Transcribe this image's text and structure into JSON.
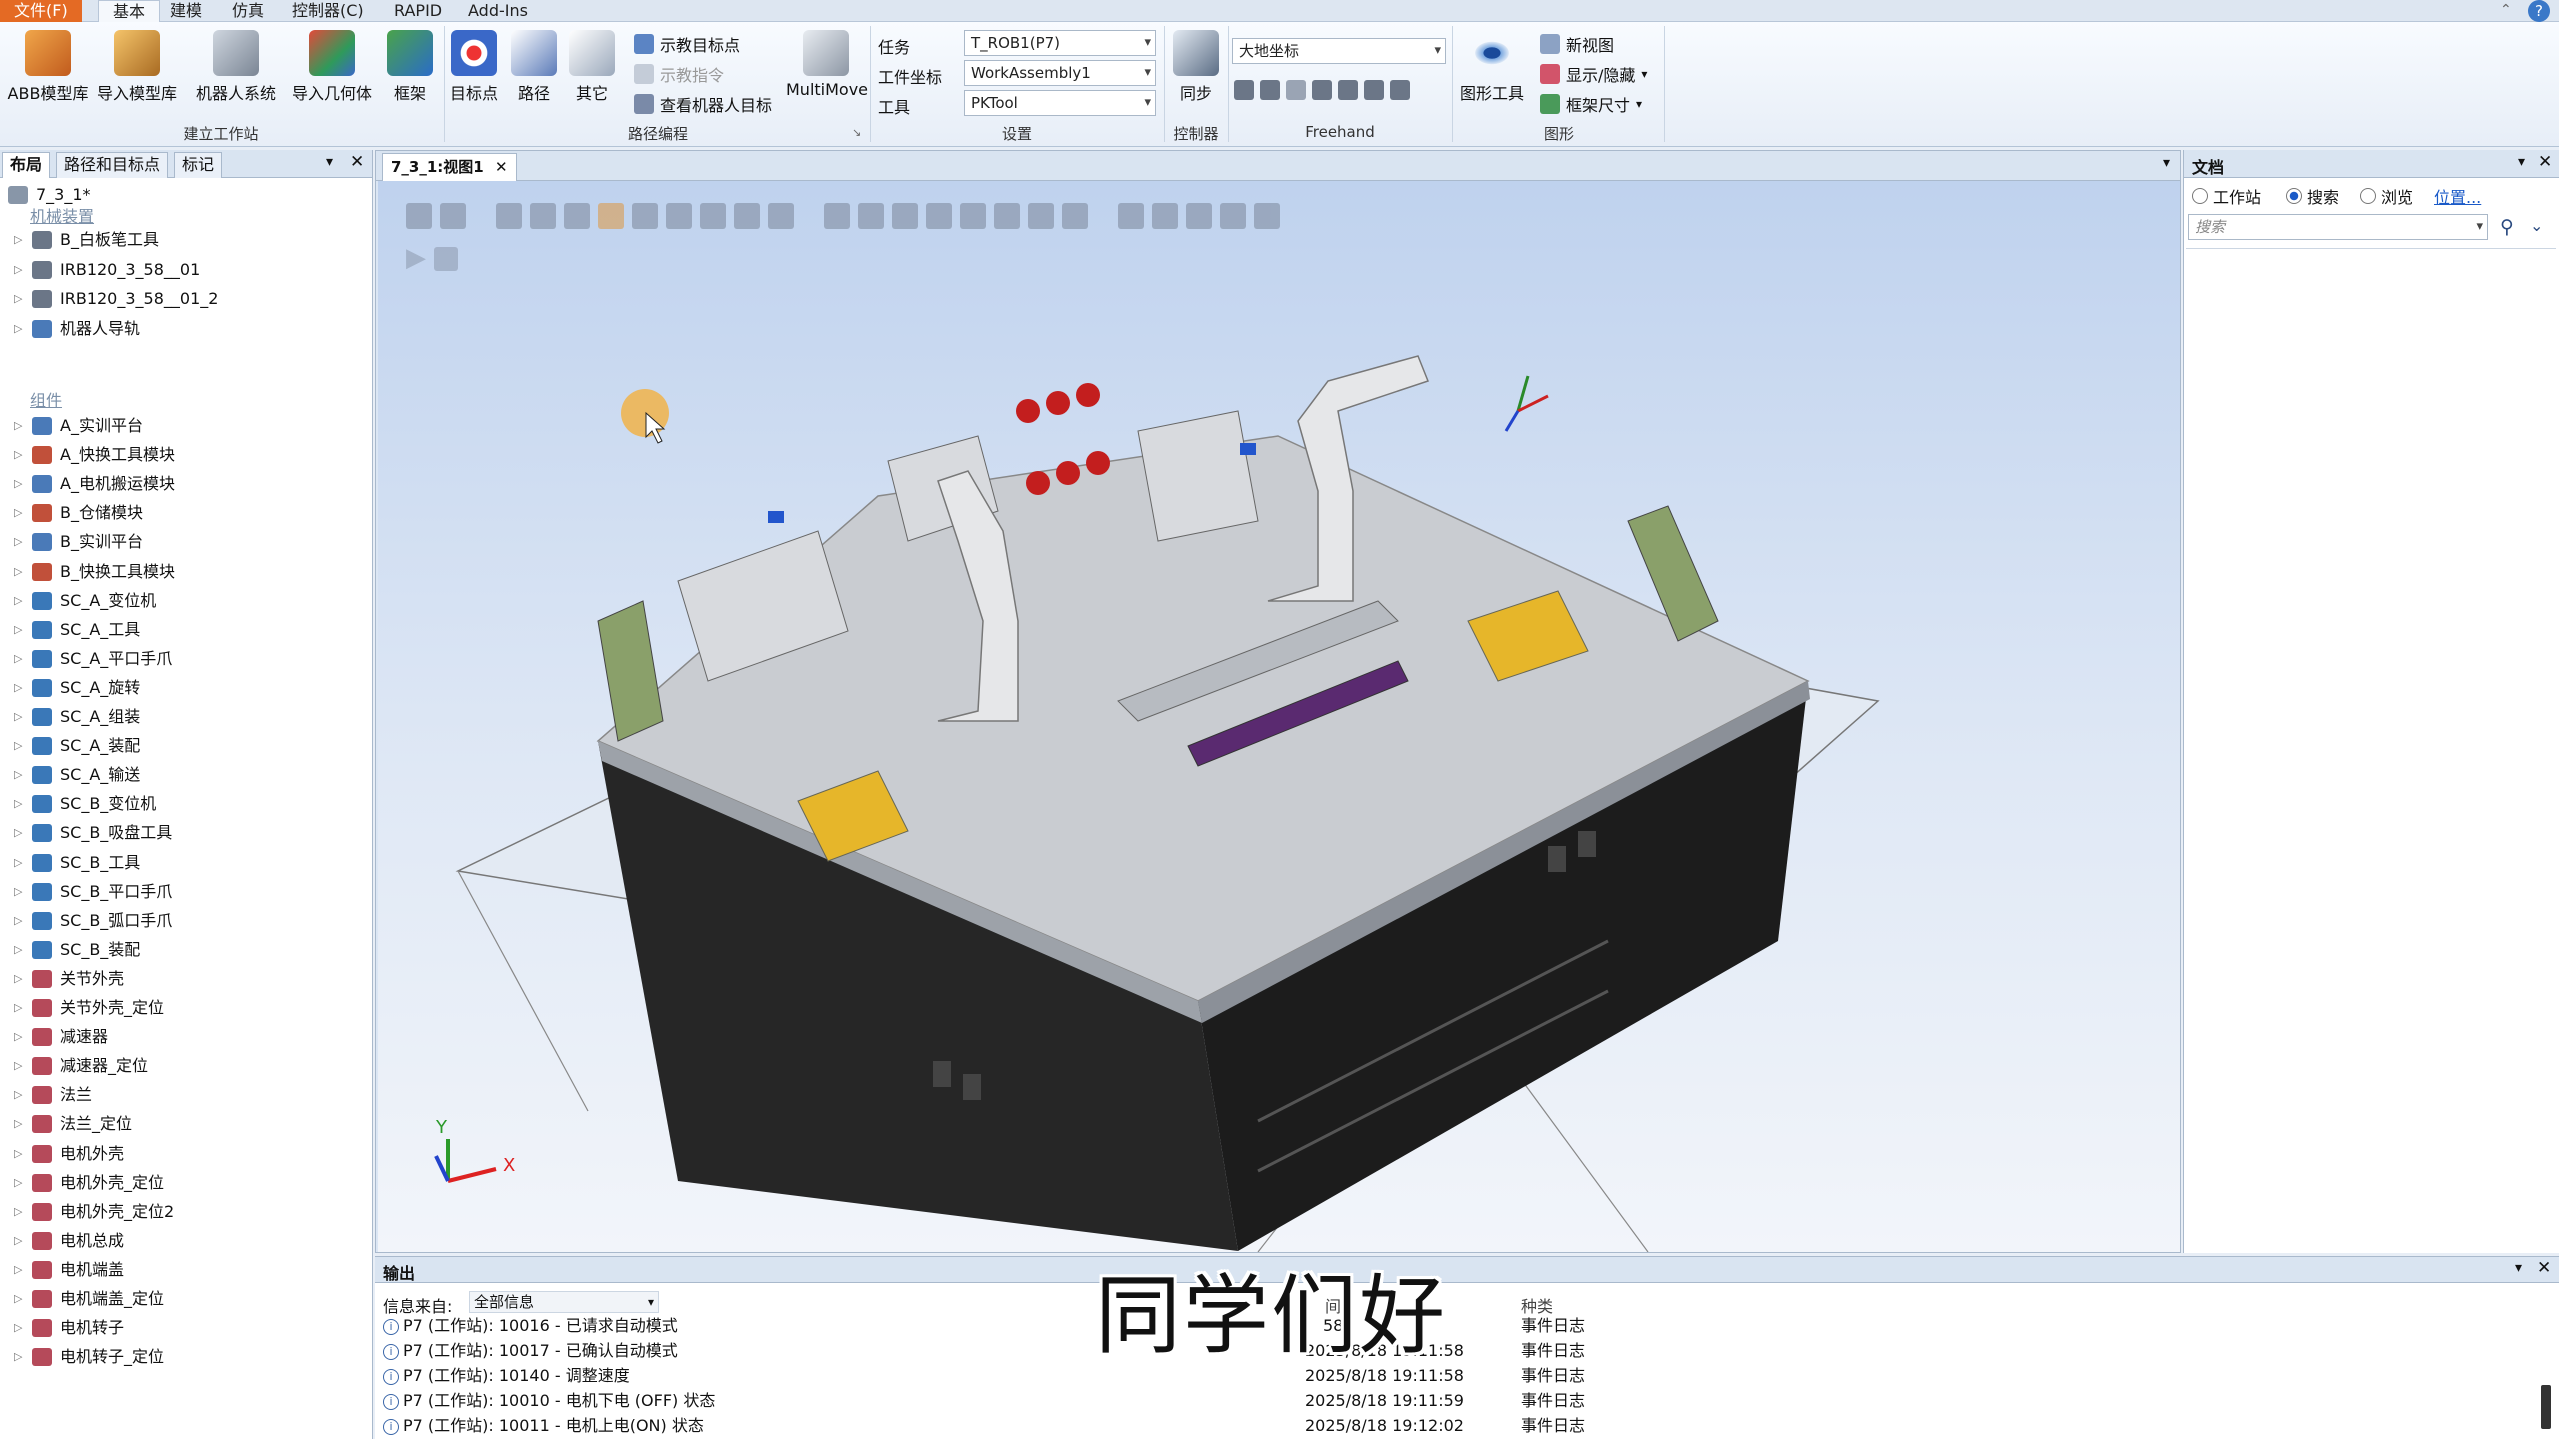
{
  "menu": {
    "file": "文件(F)",
    "tabs": [
      "基本",
      "建模",
      "仿真",
      "控制器(C)",
      "RAPID",
      "Add-Ins"
    ]
  },
  "ribbon": {
    "build_station": {
      "label": "建立工作站",
      "buttons": [
        "ABB模型库",
        "导入模型库",
        "机器人系统",
        "导入几何体",
        "框架"
      ]
    },
    "path_programming": {
      "label": "路径编程",
      "buttons": [
        "目标点",
        "路径",
        "其它"
      ],
      "small": [
        "示教目标点",
        "示教指令",
        "查看机器人目标"
      ],
      "multimove": "MultiMove"
    },
    "settings": {
      "label": "设置",
      "task_label": "任务",
      "task_value": "T_ROB1(P7)",
      "wobj_label": "工件坐标",
      "wobj_value": "WorkAssembly1",
      "tool_label": "工具",
      "tool_value": "PKTool"
    },
    "controller": {
      "label": "控制器",
      "sync": "同步"
    },
    "freehand": {
      "label": "Freehand",
      "frame_value": "大地坐标"
    },
    "graphics": {
      "label": "图形",
      "tools": "图形工具",
      "new_view": "新视图",
      "show_hide": "显示/隐藏",
      "frame_size": "框架尺寸"
    }
  },
  "left_panel": {
    "tabs": [
      "布局",
      "路径和目标点",
      "标记"
    ],
    "root": "7_3_1*",
    "mechanisms_header": "机械装置",
    "mechanisms": [
      "B_白板笔工具",
      "IRB120_3_58__01",
      "IRB120_3_58__01_2",
      "机器人导轨"
    ],
    "components_header": "组件",
    "components": [
      "A_实训平台",
      "A_快换工具模块",
      "A_电机搬运模块",
      "B_仓储模块",
      "B_实训平台",
      "B_快换工具模块",
      "SC_A_变位机",
      "SC_A_工具",
      "SC_A_平口手爪",
      "SC_A_旋转",
      "SC_A_组装",
      "SC_A_装配",
      "SC_A_输送",
      "SC_B_变位机",
      "SC_B_吸盘工具",
      "SC_B_工具",
      "SC_B_平口手爪",
      "SC_B_弧口手爪",
      "SC_B_装配",
      "关节外壳",
      "关节外壳_定位",
      "减速器",
      "减速器_定位",
      "法兰",
      "法兰_定位",
      "电机外壳",
      "电机外壳_定位",
      "电机外壳_定位2",
      "电机总成",
      "电机端盖",
      "电机端盖_定位",
      "电机转子",
      "电机转子_定位"
    ]
  },
  "viewport": {
    "tab": "7_3_1:视图1"
  },
  "doc_panel": {
    "title": "文档",
    "radio_station": "工作站",
    "radio_search": "搜索",
    "radio_browse": "浏览",
    "location_link": "位置...",
    "search_placeholder": "搜索"
  },
  "output": {
    "title": "输出",
    "source_label": "信息来自:",
    "source_value": "全部信息",
    "col_time": "间",
    "col_type": "种类",
    "rows": [
      {
        "msg": "P7 (工作站): 10016 - 已请求自动模式",
        "time": "58",
        "type": "事件日志"
      },
      {
        "msg": "P7 (工作站): 10017 - 已确认自动模式",
        "time": "2025/8/18 19:11:58",
        "type": "事件日志"
      },
      {
        "msg": "P7 (工作站): 10140 - 调整速度",
        "time": "2025/8/18 19:11:58",
        "type": "事件日志"
      },
      {
        "msg": "P7 (工作站): 10010 - 电机下电 (OFF) 状态",
        "time": "2025/8/18 19:11:59",
        "type": "事件日志"
      },
      {
        "msg": "P7 (工作站): 10011 - 电机上电(ON) 状态",
        "time": "2025/8/18 19:12:02",
        "type": "事件日志"
      }
    ]
  },
  "subtitle": "同学们好",
  "colors": {
    "file_tab": "#e46a24",
    "panel_header": "#d9e4f1",
    "scene_top": "#bfd2ee"
  }
}
